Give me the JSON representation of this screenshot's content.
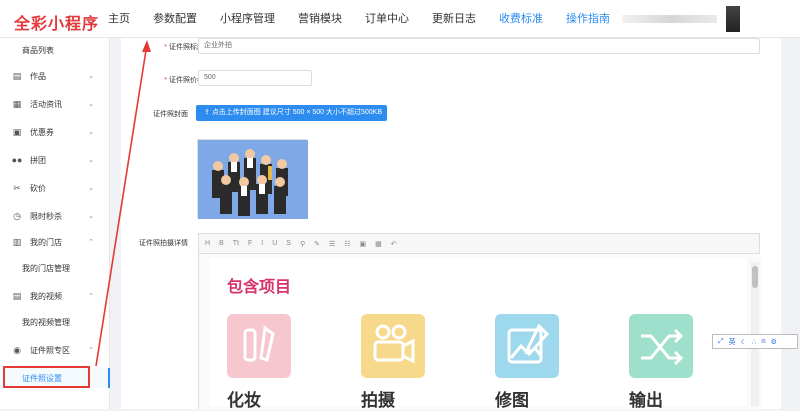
{
  "header": {
    "logo": "全彩小程序",
    "nav": [
      "主页",
      "参数配置",
      "小程序管理",
      "营销模块",
      "订单中心",
      "更新日志"
    ],
    "links": [
      "收费标准",
      "操作指南"
    ]
  },
  "sidebar": {
    "top_item": "商品列表",
    "items": [
      {
        "label": "作品",
        "icon": "film-icon"
      },
      {
        "label": "活动资讯",
        "icon": "news-icon"
      },
      {
        "label": "优惠券",
        "icon": "ticket-icon"
      },
      {
        "label": "拼团",
        "icon": "group-icon"
      },
      {
        "label": "砍价",
        "icon": "scissors-icon"
      },
      {
        "label": "限时秒杀",
        "icon": "clock-icon"
      },
      {
        "label": "我的门店",
        "icon": "store-icon"
      }
    ],
    "store_sub": "我的门店管理",
    "video": "我的视频",
    "video_sub": "我的视频管理",
    "id_zone": "证件照专区",
    "active_sub": "证件照设置"
  },
  "form": {
    "title_label": "证件照标题",
    "title_value": "企业外拍",
    "price_label": "证件照价格",
    "price_value": "500",
    "cover_label": "证件照封面",
    "upload_button": "点击上传封面图 建议尺寸 500 × 500 大小不超过500KB",
    "detail_label": "证件照拍摄详情"
  },
  "editor": {
    "toolbar": [
      "H",
      "B",
      "Tt",
      "F",
      "I",
      "U",
      "S",
      "⚲",
      "✎",
      "☰",
      "☷",
      "▣",
      "▦",
      "↶"
    ],
    "section_title": "包含项目",
    "tiles": [
      {
        "label": "化妆",
        "color": "#f6c7cf"
      },
      {
        "label": "拍摄",
        "color": "#f7d98b"
      },
      {
        "label": "修图",
        "color": "#9ed8ec"
      },
      {
        "label": "输出",
        "color": "#9ee0cc"
      }
    ]
  },
  "ime": {
    "lang": "英",
    "icons": [
      "moon-icon",
      "dots-icon",
      "user-icon",
      "gear-icon"
    ]
  },
  "colors": {
    "brand": "#e4393c",
    "primary": "#2d8cf0",
    "title_pink": "#d6336c"
  }
}
